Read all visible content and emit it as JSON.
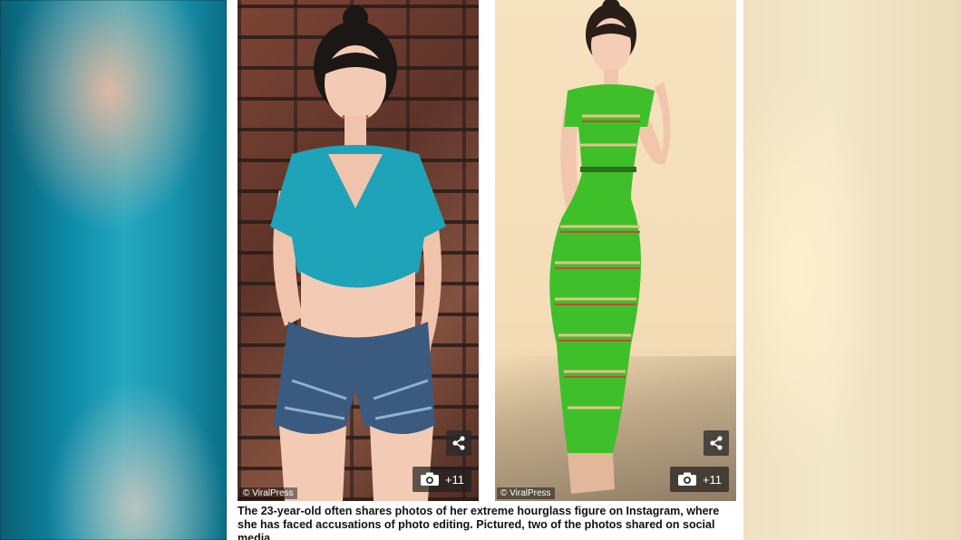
{
  "caption": "The 23-year-old often shares photos of her extreme hourglass figure on Instagram, where she has faced accusations of photo editing. Pictured, two of the photos shared on social media",
  "photos": [
    {
      "credit": "© ViralPress",
      "gallery_count": "+11",
      "share_icon": "share-icon",
      "camera_icon": "camera-icon"
    },
    {
      "credit": "© ViralPress",
      "gallery_count": "+11",
      "share_icon": "share-icon",
      "camera_icon": "camera-icon"
    }
  ],
  "colors": {
    "top_teal": "#1ea3b8",
    "dress_green": "#3fbf2a",
    "shorts_denim": "#3a5a80"
  }
}
